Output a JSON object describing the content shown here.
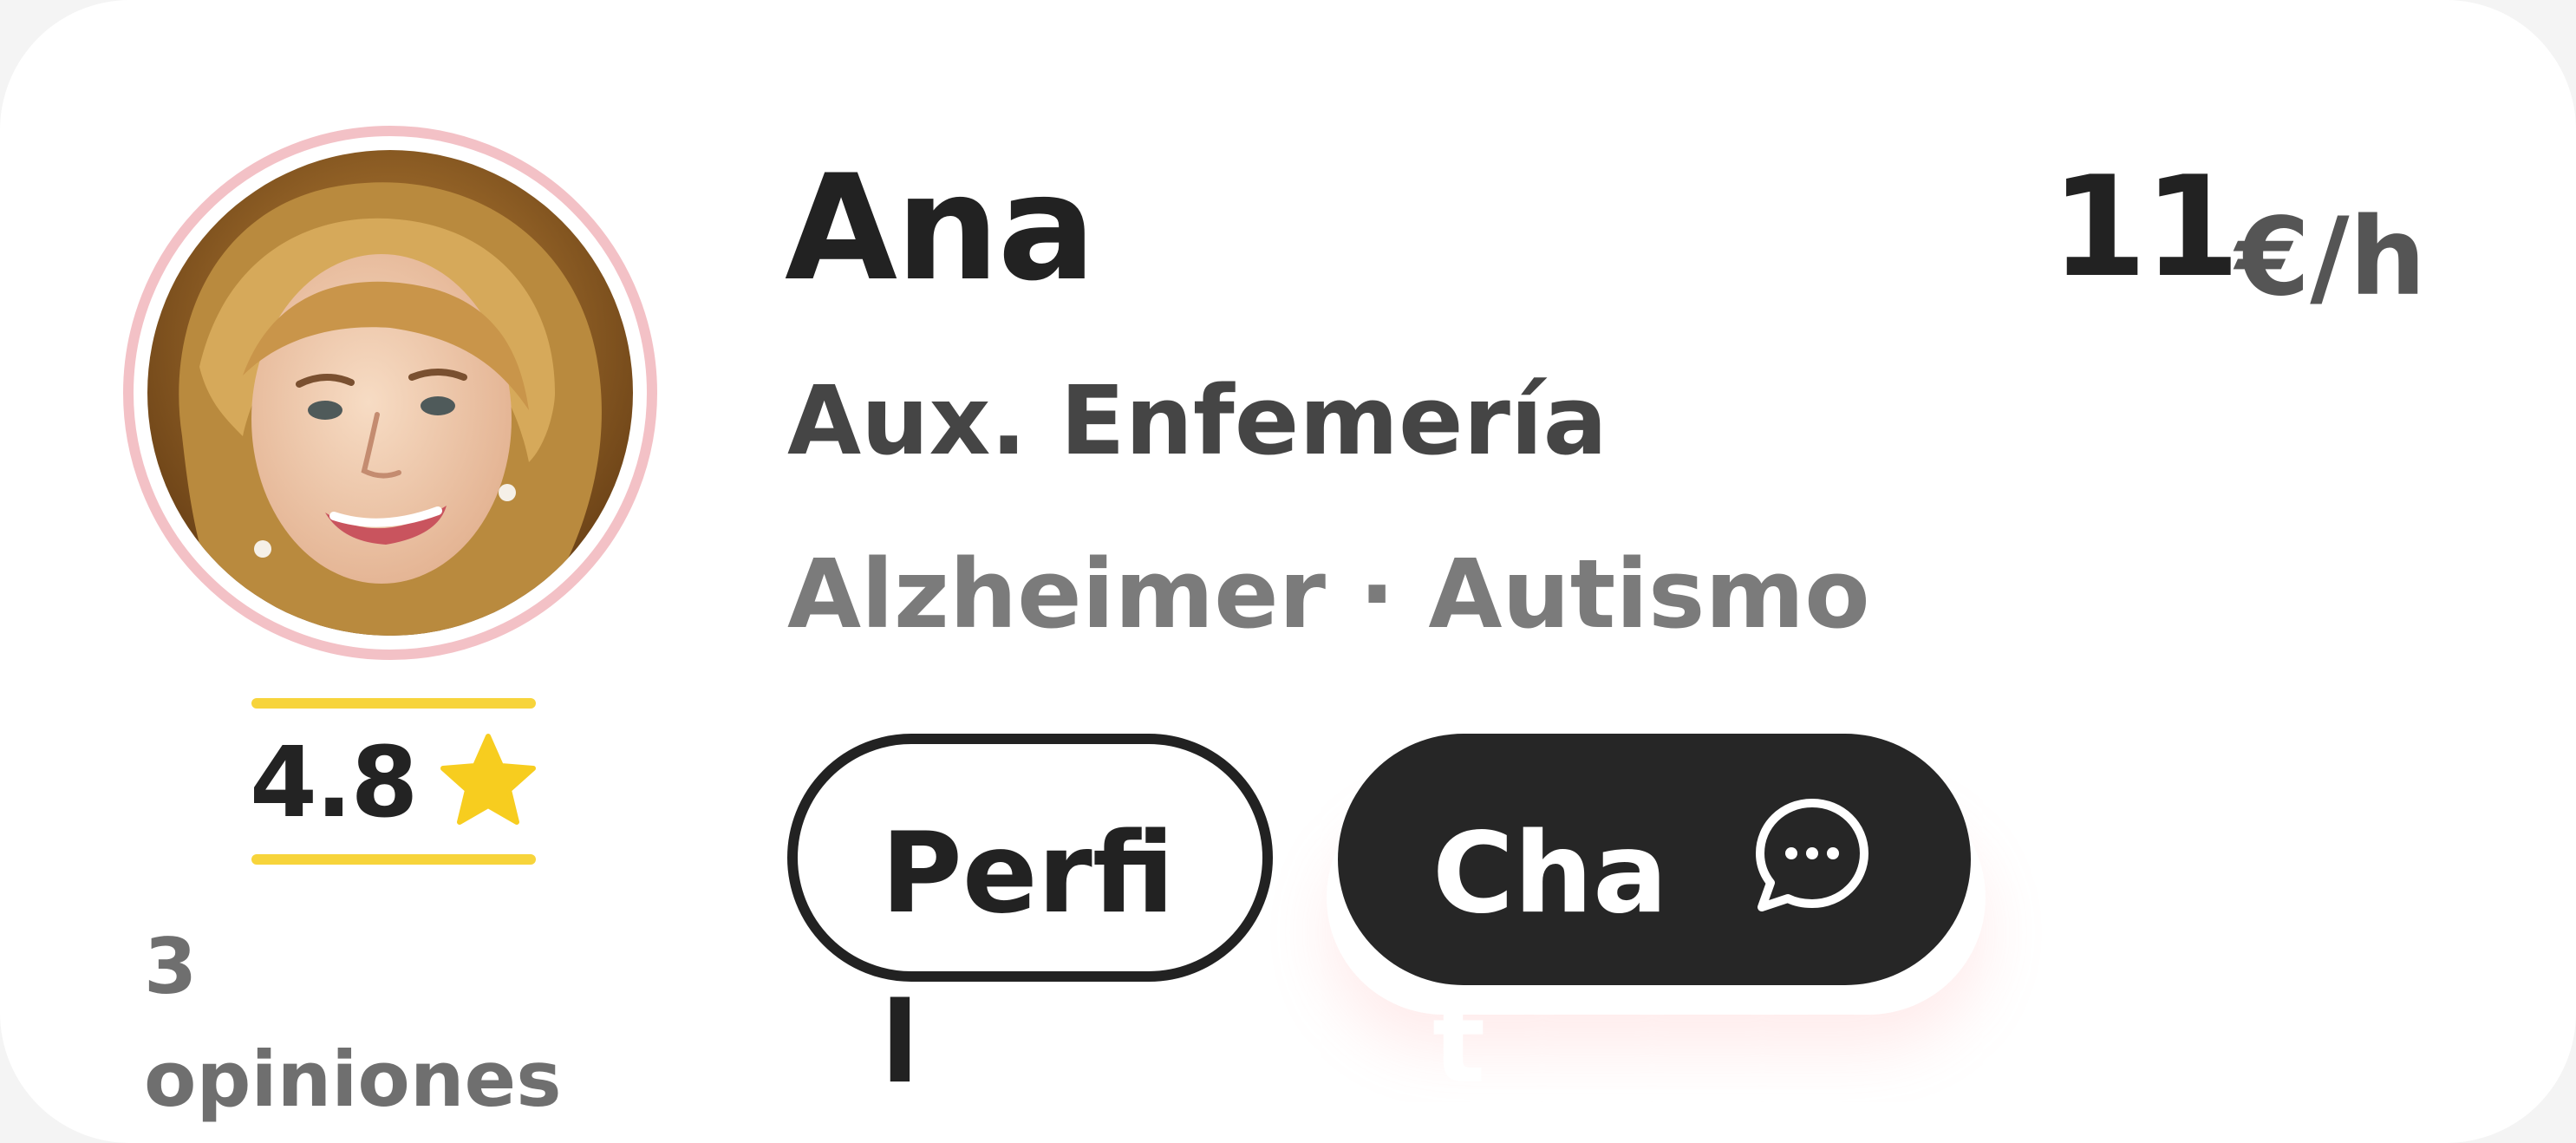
{
  "caregiver": {
    "name": "Ana",
    "profession": "Aux. Enfemería",
    "specialties": "Alzheimer · Autismo",
    "avatar_icon": "caregiver-photo"
  },
  "price": {
    "amount": "11",
    "unit": "€/h"
  },
  "rating": {
    "value": "4.8",
    "star_icon": "star-icon",
    "reviews": "3 opiniones"
  },
  "actions": {
    "profile_label": "Perfil",
    "chat_label": "Chat",
    "chat_icon": "chat-bubble-icon"
  },
  "colors": {
    "accent_yellow": "#f7d43b",
    "avatar_ring": "#f3c1c6",
    "dark_button": "#262626"
  }
}
